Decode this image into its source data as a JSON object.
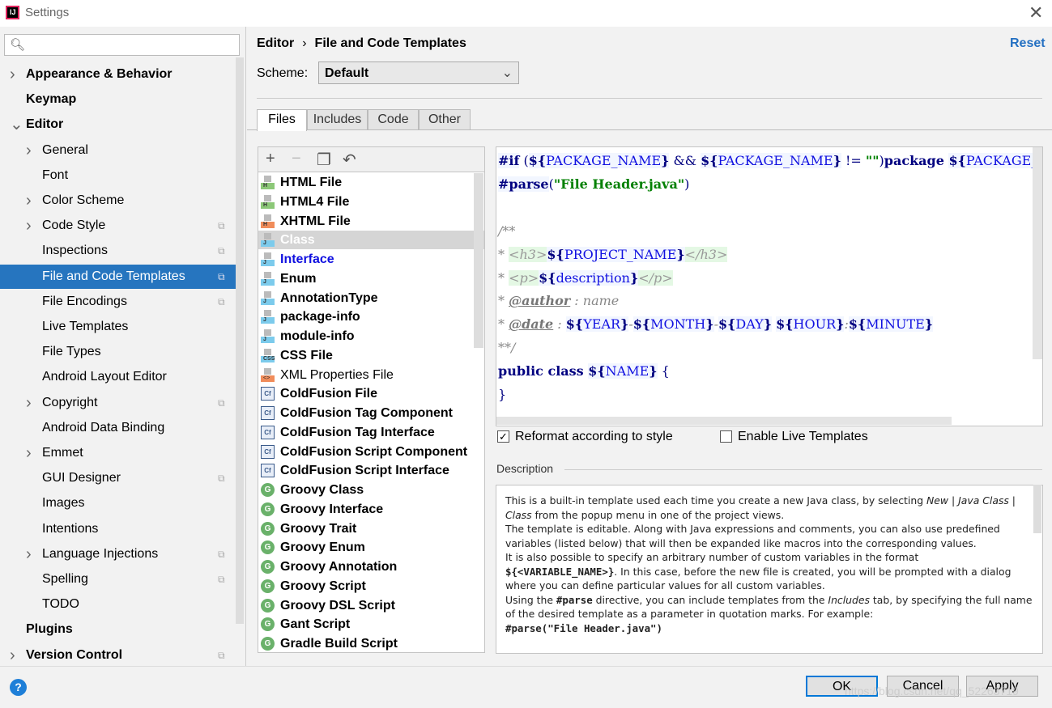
{
  "window": {
    "title": "Settings",
    "close": "✕",
    "app_icon": "IJ"
  },
  "search": {
    "icon": "🔍︎",
    "placeholder": ""
  },
  "sidebar": {
    "items": [
      {
        "label": "Appearance & Behavior",
        "level": 0,
        "arrow": "right",
        "bold": true
      },
      {
        "label": "Keymap",
        "level": 0,
        "bold": true
      },
      {
        "label": "Editor",
        "level": 0,
        "arrow": "down",
        "bold": true
      },
      {
        "label": "General",
        "level": 1,
        "arrow": "right"
      },
      {
        "label": "Font",
        "level": 1
      },
      {
        "label": "Color Scheme",
        "level": 1,
        "arrow": "right"
      },
      {
        "label": "Code Style",
        "level": 1,
        "arrow": "right",
        "copy": true
      },
      {
        "label": "Inspections",
        "level": 1,
        "copy": true
      },
      {
        "label": "File and Code Templates",
        "level": 1,
        "copy": true,
        "selected": true
      },
      {
        "label": "File Encodings",
        "level": 1,
        "copy": true
      },
      {
        "label": "Live Templates",
        "level": 1
      },
      {
        "label": "File Types",
        "level": 1
      },
      {
        "label": "Android Layout Editor",
        "level": 1
      },
      {
        "label": "Copyright",
        "level": 1,
        "arrow": "right",
        "copy": true
      },
      {
        "label": "Android Data Binding",
        "level": 1
      },
      {
        "label": "Emmet",
        "level": 1,
        "arrow": "right"
      },
      {
        "label": "GUI Designer",
        "level": 1,
        "copy": true
      },
      {
        "label": "Images",
        "level": 1
      },
      {
        "label": "Intentions",
        "level": 1
      },
      {
        "label": "Language Injections",
        "level": 1,
        "arrow": "right",
        "copy": true
      },
      {
        "label": "Spelling",
        "level": 1,
        "copy": true
      },
      {
        "label": "TODO",
        "level": 1
      },
      {
        "label": "Plugins",
        "level": 0,
        "bold": true
      },
      {
        "label": "Version Control",
        "level": 0,
        "arrow": "right",
        "bold": true,
        "copy": true
      }
    ]
  },
  "header": {
    "crumb_parent": "Editor",
    "crumb_sep": "›",
    "crumb_current": "File and Code Templates",
    "reset": "Reset"
  },
  "scheme": {
    "label": "Scheme:",
    "value": "Default"
  },
  "tabs": [
    {
      "label": "Files",
      "active": true
    },
    {
      "label": "Includes"
    },
    {
      "label": "Code"
    },
    {
      "label": "Other"
    }
  ],
  "toolbar": {
    "add": "+",
    "remove": "−",
    "copy": "❐",
    "reset": "↶"
  },
  "templates": [
    {
      "label": "HTML File",
      "icon": "html",
      "color": "#8cc878"
    },
    {
      "label": "HTML4 File",
      "icon": "html",
      "color": "#8cc878"
    },
    {
      "label": "XHTML File",
      "icon": "html",
      "color": "#f08c5a"
    },
    {
      "label": "Class",
      "icon": "java",
      "color": "#7ccbec",
      "style": "sel"
    },
    {
      "label": "Interface",
      "icon": "java",
      "color": "#7ccbec",
      "style": "blue"
    },
    {
      "label": "Enum",
      "icon": "java",
      "color": "#7ccbec"
    },
    {
      "label": "AnnotationType",
      "icon": "java",
      "color": "#7ccbec"
    },
    {
      "label": "package-info",
      "icon": "java",
      "color": "#7ccbec"
    },
    {
      "label": "module-info",
      "icon": "java",
      "color": "#7ccbec"
    },
    {
      "label": "CSS File",
      "icon": "css",
      "color": "#7ccbec"
    },
    {
      "label": "XML Properties File",
      "icon": "xml",
      "color": "#f08c5a",
      "style": "norm"
    },
    {
      "label": "ColdFusion File",
      "icon": "cf"
    },
    {
      "label": "ColdFusion Tag Component",
      "icon": "cf"
    },
    {
      "label": "ColdFusion Tag Interface",
      "icon": "cf"
    },
    {
      "label": "ColdFusion Script Component",
      "icon": "cf"
    },
    {
      "label": "ColdFusion Script Interface",
      "icon": "cf"
    },
    {
      "label": "Groovy Class",
      "icon": "groovy"
    },
    {
      "label": "Groovy Interface",
      "icon": "groovy"
    },
    {
      "label": "Groovy Trait",
      "icon": "groovy"
    },
    {
      "label": "Groovy Enum",
      "icon": "groovy"
    },
    {
      "label": "Groovy Annotation",
      "icon": "groovy"
    },
    {
      "label": "Groovy Script",
      "icon": "groovy"
    },
    {
      "label": "Groovy DSL Script",
      "icon": "groovy"
    },
    {
      "label": "Gant Script",
      "icon": "groovy"
    },
    {
      "label": "Gradle Build Script",
      "icon": "groovy"
    }
  ],
  "code": [
    [
      {
        "t": "#if",
        "c": "vb"
      },
      {
        "t": " (",
        "c": "pl"
      },
      {
        "t": "${",
        "c": "vb"
      },
      {
        "t": "PACKAGE_NAME",
        "c": "var"
      },
      {
        "t": "}",
        "c": "vb"
      },
      {
        "t": " && ",
        "c": "pl"
      },
      {
        "t": "${",
        "c": "vb"
      },
      {
        "t": "PACKAGE_NAME",
        "c": "var"
      },
      {
        "t": "}",
        "c": "vb"
      },
      {
        "t": " != ",
        "c": "pl"
      },
      {
        "t": "\"\"",
        "c": "str"
      },
      {
        "t": ")",
        "c": "pl"
      },
      {
        "t": "package ",
        "c": "kw"
      },
      {
        "t": "${",
        "c": "vb"
      },
      {
        "t": "PACKAGE_NAME",
        "c": "var"
      },
      {
        "t": "};",
        "c": "vb"
      }
    ],
    [
      {
        "t": "#parse",
        "c": "vb"
      },
      {
        "t": "(",
        "c": "pl"
      },
      {
        "t": "\"File Header.java\"",
        "c": "str"
      },
      {
        "t": ")",
        "c": "pl"
      }
    ],
    [],
    [
      {
        "t": "/**",
        "c": "cm"
      }
    ],
    [
      {
        "t": "* ",
        "c": "cm"
      },
      {
        "t": "<h3>",
        "c": "tag"
      },
      {
        "t": "${",
        "c": "vb"
      },
      {
        "t": "PROJECT_NAME",
        "c": "var"
      },
      {
        "t": "}",
        "c": "vb"
      },
      {
        "t": "</h3>",
        "c": "tag"
      }
    ],
    [
      {
        "t": "* ",
        "c": "cm"
      },
      {
        "t": "<p>",
        "c": "tag"
      },
      {
        "t": "${",
        "c": "vb"
      },
      {
        "t": "description",
        "c": "var"
      },
      {
        "t": "}",
        "c": "vb"
      },
      {
        "t": "</p>",
        "c": "tag"
      }
    ],
    [
      {
        "t": "* ",
        "c": "cm"
      },
      {
        "t": "@author",
        "c": "tagu"
      },
      {
        "t": " : name",
        "c": "cm"
      }
    ],
    [
      {
        "t": "* ",
        "c": "cm"
      },
      {
        "t": "@date",
        "c": "tagu"
      },
      {
        "t": " : ",
        "c": "cm"
      },
      {
        "t": "${",
        "c": "vb"
      },
      {
        "t": "YEAR",
        "c": "var"
      },
      {
        "t": "}",
        "c": "vb"
      },
      {
        "t": "-",
        "c": "cm"
      },
      {
        "t": "${",
        "c": "vb"
      },
      {
        "t": "MONTH",
        "c": "var"
      },
      {
        "t": "}",
        "c": "vb"
      },
      {
        "t": "-",
        "c": "cm"
      },
      {
        "t": "${",
        "c": "vb"
      },
      {
        "t": "DAY",
        "c": "var"
      },
      {
        "t": "}",
        "c": "vb"
      },
      {
        "t": " ",
        "c": "cm"
      },
      {
        "t": "${",
        "c": "vb"
      },
      {
        "t": "HOUR",
        "c": "var"
      },
      {
        "t": "}",
        "c": "vb"
      },
      {
        "t": ":",
        "c": "cm"
      },
      {
        "t": "${",
        "c": "vb"
      },
      {
        "t": "MINUTE",
        "c": "var"
      },
      {
        "t": "}",
        "c": "vb"
      }
    ],
    [
      {
        "t": "**/",
        "c": "cm"
      }
    ],
    [
      {
        "t": "public class ",
        "c": "kw"
      },
      {
        "t": "${",
        "c": "vb"
      },
      {
        "t": "NAME",
        "c": "var"
      },
      {
        "t": "}",
        "c": "vb"
      },
      {
        "t": " {",
        "c": "pl"
      }
    ],
    [
      {
        "t": "}",
        "c": "pl"
      }
    ]
  ],
  "options": {
    "reformat": {
      "label": "Reformat according to style",
      "checked": true
    },
    "live": {
      "label": "Enable Live Templates",
      "checked": false
    }
  },
  "description": {
    "label": "Description",
    "html": "This is a built-in template used each time you create a new Java class, by selecting <i>New</i> | <i>Java Class</i> | <i>Class</i> from the popup menu in one of the project views.<br>The template is editable. Along with Java expressions and comments, you can also use predefined variables (listed below) that will then be expanded like macros into the corresponding values.<br>It is also possible to specify an arbitrary number of custom variables in the format <b>${&lt;VARIABLE_NAME&gt;}</b>. In this case, before the new file is created, you will be prompted with a dialog where you can define particular values for all custom variables.<br>Using the <b>#parse</b> directive, you can include templates from the <i>Includes</i> tab, by specifying the full name of the desired template as a parameter in quotation marks. For example:<br><b>#parse(\"File Header.java\")</b>"
  },
  "buttons": {
    "ok": "OK",
    "cancel": "Cancel",
    "apply": "Apply",
    "help": "?"
  },
  "watermark": "https://blog.csdn.net/qq_52263719"
}
